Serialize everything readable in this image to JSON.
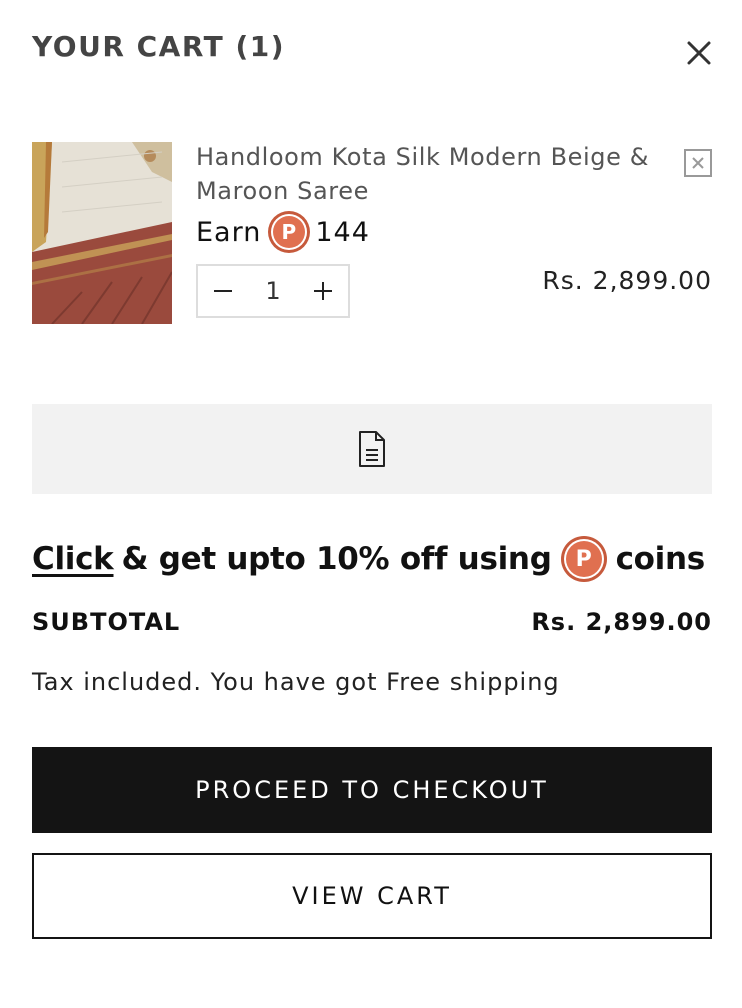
{
  "cart": {
    "title": "YOUR CART (1)"
  },
  "item": {
    "name": "Handloom Kota Silk Modern Beige & Maroon Saree",
    "earn_label": "Earn",
    "coin_letter": "P",
    "earn_points": "144",
    "quantity": "1",
    "price": "Rs. 2,899.00"
  },
  "promo": {
    "click_text": "Click",
    "text_before_coin": "& get upto 10% off using",
    "coin_letter": "P",
    "text_after_coin": "coins"
  },
  "summary": {
    "subtotal_label": "SUBTOTAL",
    "subtotal_value": "Rs. 2,899.00",
    "tax_note": "Tax included. You have got Free shipping"
  },
  "actions": {
    "checkout_label": "PROCEED TO CHECKOUT",
    "view_cart_label": "VIEW CART"
  },
  "icons": {
    "close": "close-icon",
    "remove": "remove-item-icon",
    "minus": "minus-icon",
    "plus": "plus-icon",
    "note": "document-note-icon",
    "coin": "coin-icon"
  },
  "colors": {
    "coin": "#e07050",
    "button_dark": "#141414",
    "note_bar_bg": "#f2f2f2"
  }
}
